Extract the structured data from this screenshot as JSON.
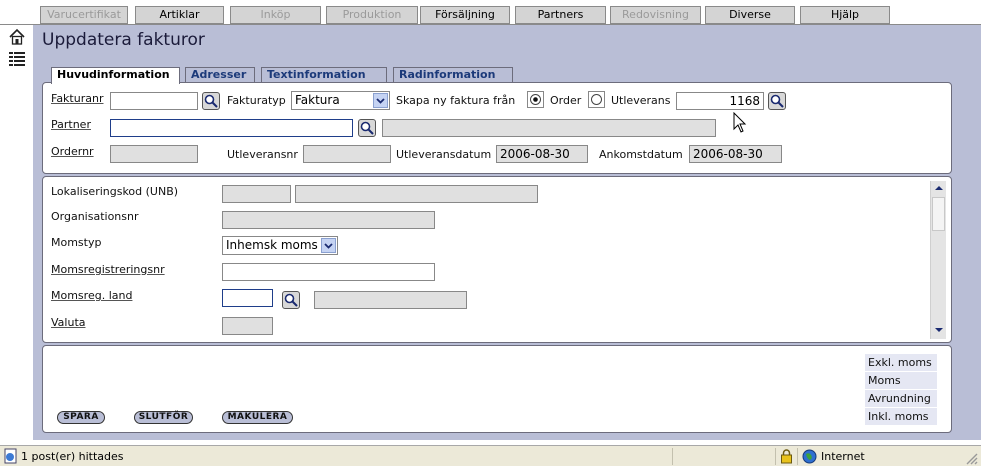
{
  "topnav": {
    "items": [
      {
        "label": "Varucertifikat",
        "disabled": true
      },
      {
        "label": "Artiklar",
        "disabled": false
      },
      {
        "label": "Inköp",
        "disabled": true
      },
      {
        "label": "Produktion",
        "disabled": true
      },
      {
        "label": "Försäljning",
        "disabled": false
      },
      {
        "label": "Partners",
        "disabled": false
      },
      {
        "label": "Redovisning",
        "disabled": true
      },
      {
        "label": "Diverse",
        "disabled": false
      },
      {
        "label": "Hjälp",
        "disabled": false
      }
    ]
  },
  "leftbar": {
    "icons": [
      "home-icon",
      "list-icon"
    ]
  },
  "page": {
    "title": "Uppdatera fakturor"
  },
  "tabs": [
    {
      "label": "Huvudinformation",
      "active": true
    },
    {
      "label": "Adresser",
      "active": false
    },
    {
      "label": "Textinformation",
      "active": false
    },
    {
      "label": "Radinformation",
      "active": false
    }
  ],
  "header_form": {
    "fakturanr_label": "Fakturanr",
    "fakturanr_value": "",
    "fakturatyp_label": "Fakturatyp",
    "fakturatyp_value": "Faktura",
    "skapa_label": "Skapa ny faktura från",
    "order_label": "Order",
    "order_selected": true,
    "utleverans_label": "Utleverans",
    "utleverans_selected": false,
    "utleverans_value": "1168",
    "partner_label": "Partner",
    "partner_value": "",
    "partner_name_value": "",
    "ordernr_label": "Ordernr",
    "ordernr_value": "",
    "utleveransnr_label": "Utleveransnr",
    "utleveransnr_value": "",
    "utleveransdatum_label": "Utleveransdatum",
    "utleveransdatum_value": "2006-08-30",
    "ankomstdatum_label": "Ankomstdatum",
    "ankomstdatum_value": "2006-08-30"
  },
  "detail_form": {
    "lokaliseringskod_label": "Lokaliseringskod (UNB)",
    "organisationsnr_label": "Organisationsnr",
    "momstyp_label": "Momstyp",
    "momstyp_value": "Inhemsk moms",
    "momsregnr_label": "Momsregistreringsnr",
    "momsregland_label": "Momsreg. land",
    "valuta_label": "Valuta"
  },
  "footer": {
    "spara_label": "SPARA",
    "slutfor_label": "SLUTFÖR",
    "makulera_label": "MAKULERA",
    "sums": [
      "Exkl. moms",
      "Moms",
      "Avrundning",
      "Inkl. moms"
    ]
  },
  "statusbar": {
    "message": "1 post(er) hittades",
    "zone": "Internet"
  },
  "colors": {
    "main_bg": "#b9bed6",
    "tab_text": "#1c3a7a",
    "nav_bg": "#d4d4d4"
  }
}
